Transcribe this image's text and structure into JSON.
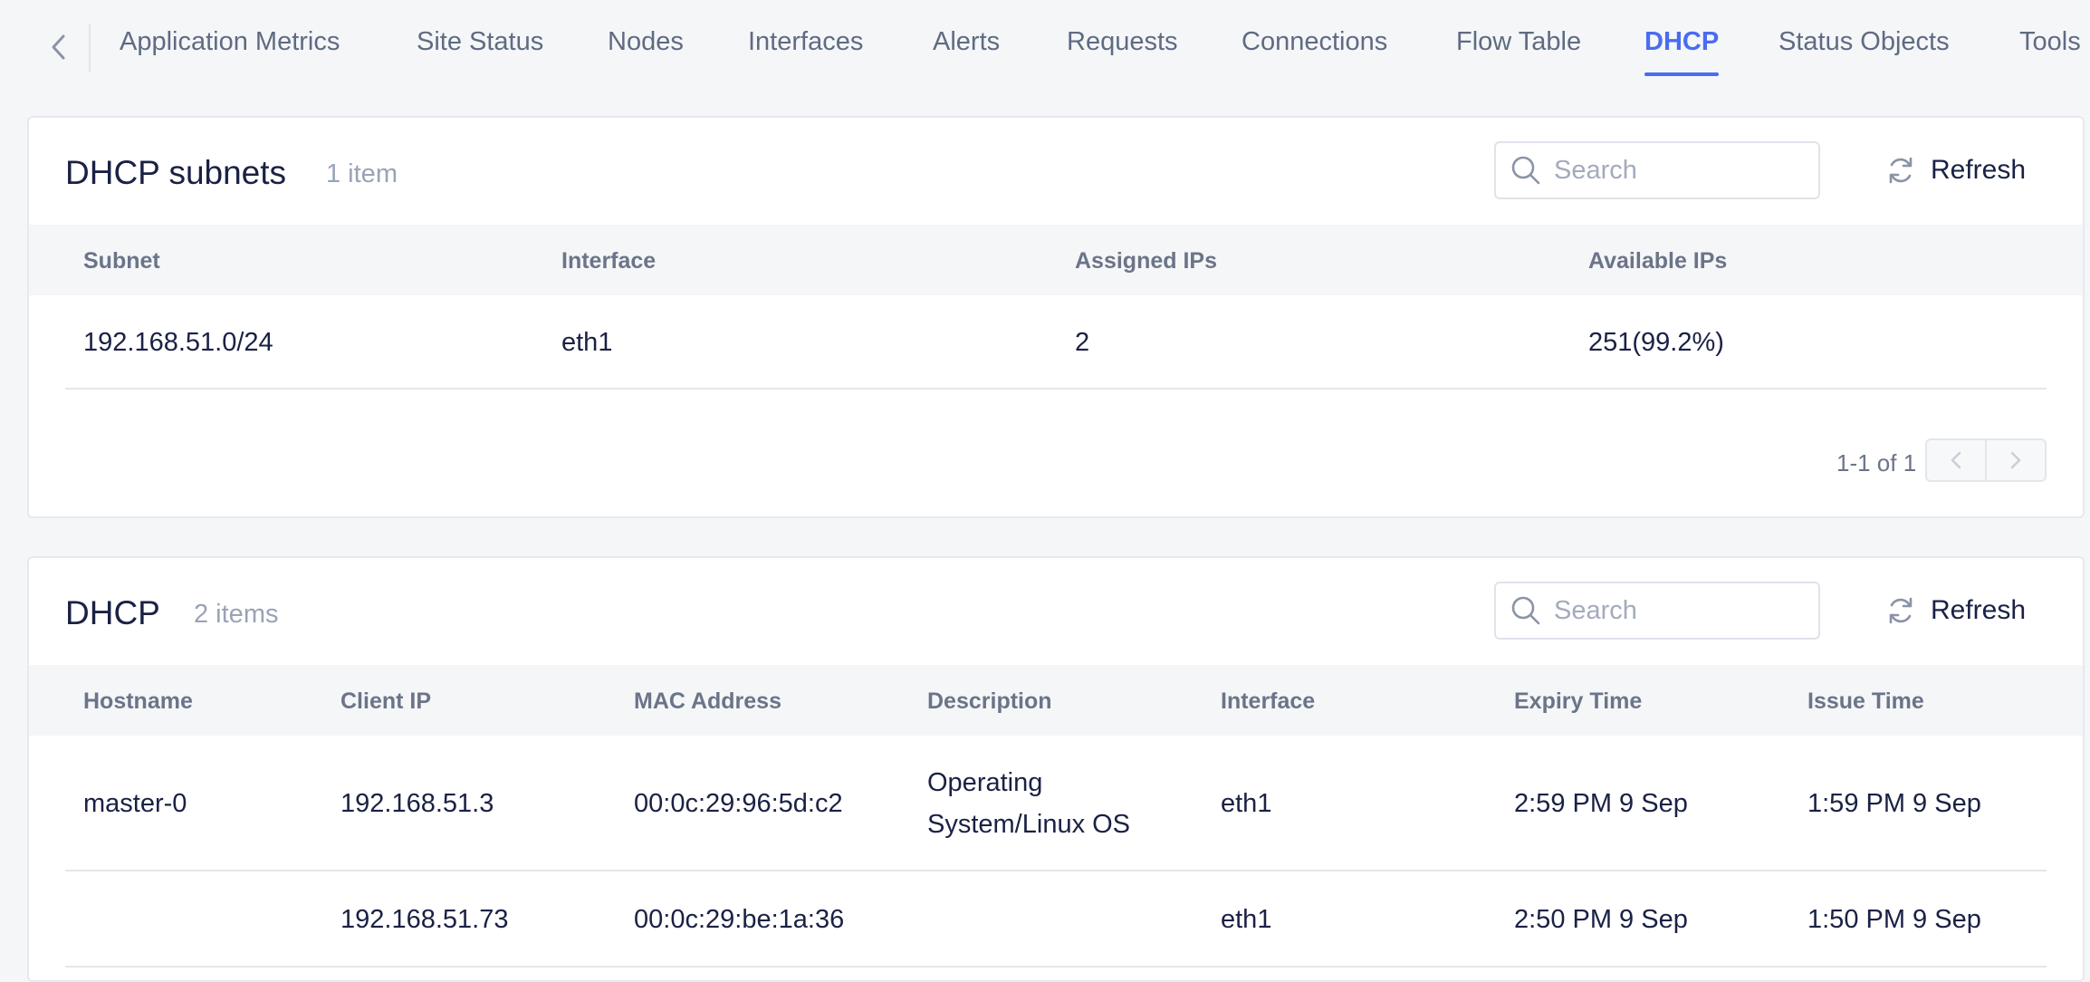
{
  "nav": {
    "tabs": [
      {
        "label": "Application Metrics"
      },
      {
        "label": "Site Status"
      },
      {
        "label": "Nodes"
      },
      {
        "label": "Interfaces"
      },
      {
        "label": "Alerts"
      },
      {
        "label": "Requests"
      },
      {
        "label": "Connections"
      },
      {
        "label": "Flow Table"
      },
      {
        "label": "DHCP",
        "active": true
      },
      {
        "label": "Status Objects"
      },
      {
        "label": "Tools"
      }
    ],
    "accent_color": "#4a6cf0"
  },
  "subnets": {
    "title": "DHCP subnets",
    "count": "1 item",
    "search_placeholder": "Search",
    "refresh_label": "Refresh",
    "columns": [
      "Subnet",
      "Interface",
      "Assigned IPs",
      "Available IPs"
    ],
    "rows": [
      {
        "subnet": "192.168.51.0/24",
        "interface": "eth1",
        "assigned": "2",
        "available": "251(99.2%)"
      }
    ],
    "pagination": "1-1 of 1"
  },
  "leases": {
    "title": "DHCP",
    "count": "2 items",
    "search_placeholder": "Search",
    "refresh_label": "Refresh",
    "columns": [
      "Hostname",
      "Client IP",
      "MAC Address",
      "Description",
      "Interface",
      "Expiry Time",
      "Issue Time"
    ],
    "rows": [
      {
        "hostname": "master-0",
        "client_ip": "192.168.51.3",
        "mac": "00:0c:29:96:5d:c2",
        "description_line1": "Operating",
        "description_line2": "System/Linux OS",
        "interface": "eth1",
        "expiry": "2:59 PM 9 Sep",
        "issue": "1:59 PM 9 Sep"
      },
      {
        "hostname": "",
        "client_ip": "192.168.51.73",
        "mac": "00:0c:29:be:1a:36",
        "description_line1": "",
        "description_line2": "",
        "interface": "eth1",
        "expiry": "2:50 PM 9 Sep",
        "issue": "1:50 PM 9 Sep"
      }
    ]
  }
}
